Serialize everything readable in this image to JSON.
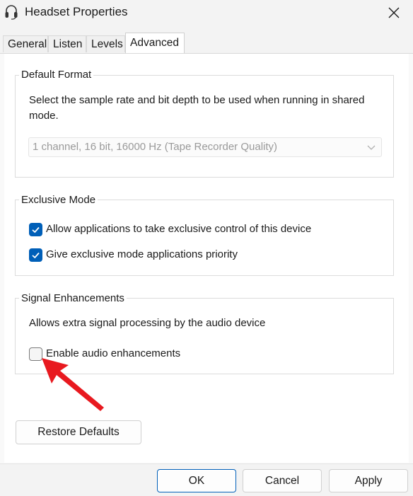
{
  "window": {
    "title": "Headset Properties",
    "icons": {
      "app": "headset-icon",
      "close": "close-icon"
    }
  },
  "tabs": [
    {
      "label": "General",
      "active": false
    },
    {
      "label": "Listen",
      "active": false
    },
    {
      "label": "Levels",
      "active": false
    },
    {
      "label": "Advanced",
      "active": true
    }
  ],
  "default_format": {
    "title": "Default Format",
    "description": "Select the sample rate and bit depth to be used when running in shared mode.",
    "select_value": "1 channel, 16 bit, 16000 Hz (Tape Recorder Quality)",
    "select_enabled": false
  },
  "exclusive_mode": {
    "title": "Exclusive Mode",
    "options": [
      {
        "label": "Allow applications to take exclusive control of this device",
        "checked": true
      },
      {
        "label": "Give exclusive mode applications priority",
        "checked": true
      }
    ]
  },
  "signal_enhancements": {
    "title": "Signal Enhancements",
    "description": "Allows extra signal processing by the audio device",
    "option": {
      "label": "Enable audio enhancements",
      "checked": false
    }
  },
  "buttons": {
    "restore_defaults": "Restore Defaults",
    "ok": "OK",
    "cancel": "Cancel",
    "apply": "Apply"
  },
  "annotation": {
    "icon": "red-arrow-icon",
    "color": "#e8191f"
  },
  "colors": {
    "accent": "#005fb8",
    "arrow": "#e8191f"
  }
}
